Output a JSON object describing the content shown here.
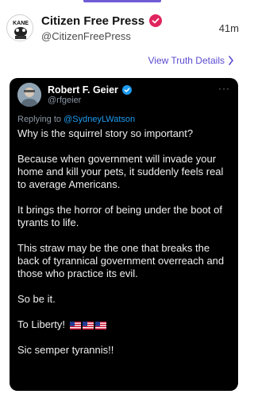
{
  "post": {
    "author": "Citizen Free Press",
    "handle": "@CitizenFreePress",
    "time": "41m",
    "view_details": "View Truth Details",
    "avatar_text": "KANE"
  },
  "embed": {
    "author": "Robert F. Geier",
    "handle": "@rfgeier",
    "replying_prefix": "Replying to ",
    "replying_to": "@SydneyLWatson",
    "paragraphs": [
      "Why is the squirrel story so important?",
      "Because when government will invade your home and kill your pets, it suddenly feels real to average Americans.",
      "It brings the horror of being under the boot of tyrants to life.",
      "This straw may be the one that breaks the back of tyrannical government overreach and those who practice its evil.",
      "So be it.",
      "To Liberty!",
      "Sic semper tyrannis!!"
    ],
    "more": "···"
  },
  "colors": {
    "accent": "#6e5cd6",
    "badge": "#e0245e",
    "twitter_blue": "#1d9bf0"
  },
  "icons": [
    "verified-badge-icon",
    "chevron-right-icon",
    "more-icon",
    "us-flag-icon"
  ]
}
